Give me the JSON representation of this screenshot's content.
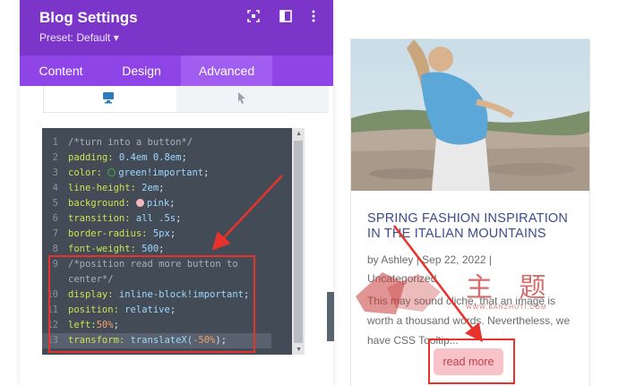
{
  "panel": {
    "title": "Blog Settings",
    "preset": "Preset: Default ▾",
    "tabs": [
      {
        "label": "Content"
      },
      {
        "label": "Design"
      },
      {
        "label": "Advanced"
      }
    ],
    "header_icons": [
      "focus-icon",
      "split-view-icon",
      "more-options-icon"
    ],
    "device_tabs": [
      "desktop-icon",
      "hover-cursor-icon"
    ]
  },
  "editor": {
    "lines": [
      {
        "n": "1",
        "comment": "/*turn into a button*/"
      },
      {
        "n": "2",
        "prop": "padding:",
        "val": " 0.4em 0.8em",
        "end": ";"
      },
      {
        "n": "3",
        "prop": "color:",
        "dot": "#3fae3f",
        "val": "green!important",
        "end": ";"
      },
      {
        "n": "4",
        "prop": "line-height:",
        "val": " 2em",
        "end": ";"
      },
      {
        "n": "5",
        "prop": "background:",
        "dot": "#f4b7c0",
        "val": "pink",
        "end": ";"
      },
      {
        "n": "6",
        "prop": "transition:",
        "val": " all .5s",
        "end": ";"
      },
      {
        "n": "7",
        "prop": "border-radius:",
        "val": " 5px",
        "end": ";"
      },
      {
        "n": "8",
        "prop": "font-weight:",
        "val": " 500",
        "end": ";"
      },
      {
        "n": "9",
        "comment": "/*position read more button to"
      },
      {
        "n": "",
        "comment": "center*/"
      },
      {
        "n": "10",
        "prop": "display:",
        "val": " inline-block!important",
        "end": ";"
      },
      {
        "n": "11",
        "prop": "position:",
        "val": " relative",
        "end": ";"
      },
      {
        "n": "12",
        "prop": "left:",
        "pct": "50%",
        "end": ";"
      },
      {
        "n": "13",
        "prop": "transform:",
        "val": " translateX(",
        "pct": "-50%",
        "end": ");"
      }
    ]
  },
  "post": {
    "title": "SPRING FASHION INSPIRATION IN THE ITALIAN MOUNTAINS",
    "meta_line1": "by Ashley | Sep 22, 2022 |",
    "meta_line2": "Uncategorized",
    "excerpt": "This may sound cliche, that an image is worth a thousand words. Nevertheless, we have CSS Tooltip...",
    "read_more": "read more"
  },
  "watermark": {
    "text": "主 题",
    "url": "WWW.BANZHUTI.COM"
  },
  "colors": {
    "panel_purple": "#7b35c9",
    "tab_purple": "#8e44e6",
    "highlight_red": "#e8322b",
    "editor_bg": "#434b56",
    "button_pink": "#f7c3c8"
  }
}
